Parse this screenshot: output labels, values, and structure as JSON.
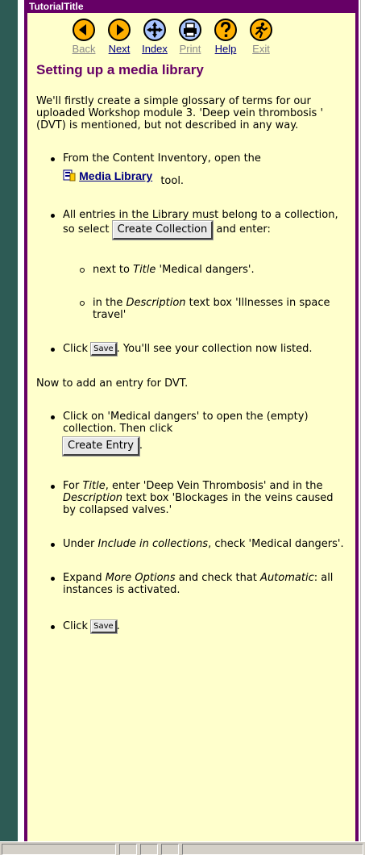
{
  "window": {
    "title": "TutorialTitle"
  },
  "nav": {
    "back": "Back",
    "next": "Next",
    "index": "Index",
    "print": "Print",
    "help": "Help",
    "exit": "Exit"
  },
  "content": {
    "heading": "Setting up a media library",
    "intro": "We'll firstly create a simple glossary of terms for our uploaded Workshop module 3. 'Deep vein thrombosis ' (DVT) is mentioned, but not described in any way.",
    "step1_pre": "From the Content Inventory, open the",
    "step1_link": "Media Library",
    "step1_post": "tool.",
    "step2_pre": "All entries in the Library must belong to a collection, so select",
    "step2_button": "Create Collection",
    "step2_post": "and enter:",
    "sub1_pre": "next to",
    "sub1_em": "Title",
    "sub1_post": "'Medical dangers'.",
    "sub2_pre": "in the",
    "sub2_em": "Description",
    "sub2_post": "text box 'Illnesses in space travel'",
    "step3_pre": "Click",
    "step3_button": "Save",
    "step3_post": ". You'll see your collection now listed.",
    "para2": "Now to add an entry for DVT.",
    "step4_pre": "Click on 'Medical dangers' to open the (empty) collection. Then click",
    "step4_button": "Create Entry",
    "step4_post": ".",
    "step5_pre": "For",
    "step5_em1": "Title",
    "step5_mid": ", enter 'Deep Vein Thrombosis' and in the",
    "step5_em2": "Description",
    "step5_post": "text box 'Blockages in the veins caused by collapsed valves.'",
    "step6_pre": "Under",
    "step6_em": "Include in collections",
    "step6_post": ", check 'Medical dangers'.",
    "step7_pre": "Expand",
    "step7_em1": "More Options",
    "step7_mid": "and check that",
    "step7_em2": "Automatic",
    "step7_post": ": all instances is activated.",
    "step8_pre": "Click",
    "step8_button": "Save",
    "step8_post": "."
  },
  "colors": {
    "accent": "#660066",
    "page_background": "#ffffcc",
    "nav_icon": "#ffb000",
    "link": "#000080"
  },
  "icons": [
    "back-icon",
    "next-icon",
    "index-icon",
    "print-icon",
    "help-icon",
    "exit-icon",
    "media-library-icon"
  ]
}
